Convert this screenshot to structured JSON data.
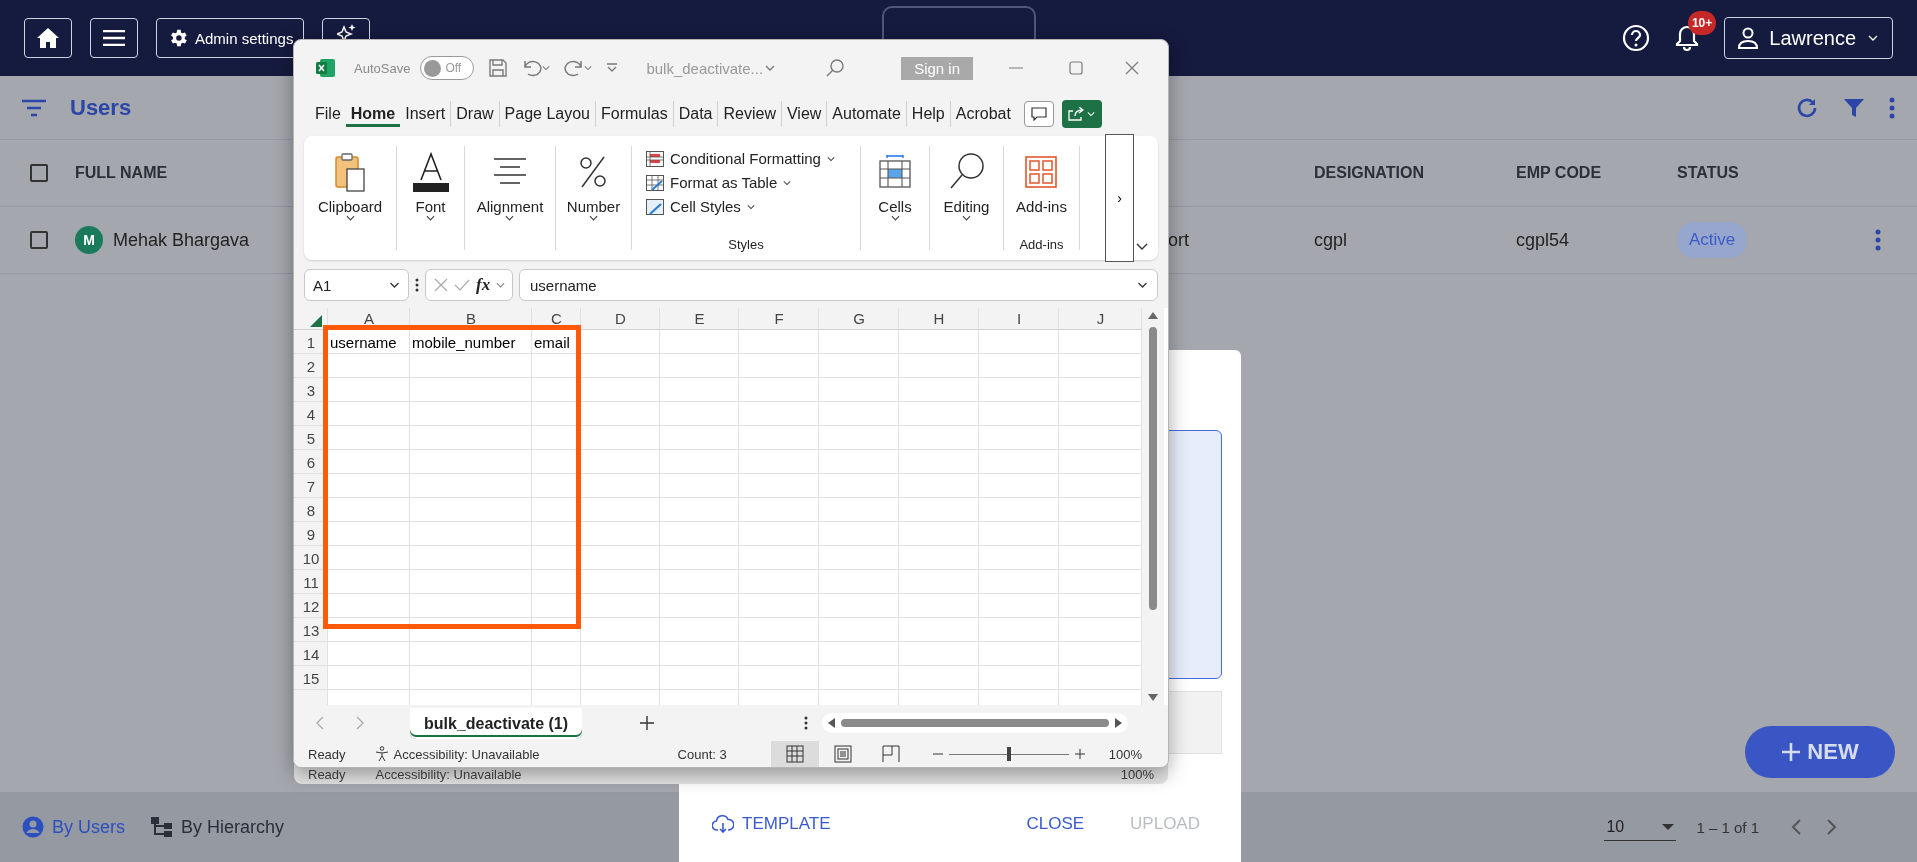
{
  "navbar": {
    "admin_button": "Admin settings",
    "notification_badge": "10+",
    "user_button": "Lawrence"
  },
  "users_header": {
    "title": "Users"
  },
  "table": {
    "header_checked": false,
    "columns": [
      "FULL NAME",
      "DESIGNATION",
      "EMP CODE",
      "STATUS"
    ],
    "rows": [
      {
        "checked": false,
        "avatar": "M",
        "full_name": "Mehak Bhargava",
        "column_3": "ort",
        "designation": "cgpl",
        "emp_code": "cgpl54",
        "status": "Active"
      }
    ]
  },
  "fab": {
    "label": "NEW"
  },
  "footer": {
    "views": [
      {
        "label": "By Users",
        "selected": true
      },
      {
        "label": "By Hierarchy",
        "selected": false
      }
    ],
    "page_size": "10",
    "range": "1 – 1 of 1"
  },
  "dialog": {
    "buttons": [
      {
        "label": "TEMPLATE",
        "disabled": false
      },
      {
        "label": "CLOSE",
        "disabled": false
      },
      {
        "label": "UPLOAD",
        "disabled": true
      }
    ]
  },
  "ghost_status_bar": {
    "ready": "Ready",
    "accessibility": "Accessibility: Unavailable",
    "zoom": "100%"
  },
  "excel": {
    "autosave_label": "AutoSave",
    "autosave": {
      "on": false,
      "label": "Off"
    },
    "file_name": "bulk_deactivate...",
    "sign_in": "Sign in",
    "menu_tabs": [
      {
        "label": "File",
        "selected": false
      },
      {
        "label": "Home",
        "selected": true
      },
      {
        "label": "Insert",
        "selected": false
      },
      {
        "label": "Draw",
        "selected": false
      },
      {
        "label": "Page Layou",
        "selected": false
      },
      {
        "label": "Formulas",
        "selected": false
      },
      {
        "label": "Data",
        "selected": false
      },
      {
        "label": "Review",
        "selected": false
      },
      {
        "label": "View",
        "selected": false
      },
      {
        "label": "Automate",
        "selected": false
      },
      {
        "label": "Help",
        "selected": false
      },
      {
        "label": "Acrobat",
        "selected": false
      }
    ],
    "ribbon": [
      {
        "kind": "big",
        "label": "Clipboard"
      },
      {
        "kind": "big",
        "label": "Font"
      },
      {
        "kind": "big",
        "label": "Alignment"
      },
      {
        "kind": "big",
        "label": "Number"
      },
      {
        "kind": "list",
        "items": [
          "Conditional Formatting",
          "Format as Table",
          "Cell Styles"
        ],
        "group_label": "Styles"
      },
      {
        "kind": "big",
        "label": "Cells"
      },
      {
        "kind": "big",
        "label": "Editing"
      },
      {
        "kind": "addin",
        "label": "Add-ins",
        "group_label": "Add-ins"
      }
    ],
    "ribbon_overflow": "›",
    "name_box": "A1",
    "fx": "fx",
    "formula": "username",
    "columns": [
      "A",
      "B",
      "C",
      "D",
      "E",
      "F",
      "G",
      "H",
      "I",
      "J"
    ],
    "rows": [
      "1",
      "2",
      "3",
      "4",
      "5",
      "6",
      "7",
      "8",
      "9",
      "10",
      "11",
      "12",
      "13",
      "14",
      "15"
    ],
    "cells": [
      [
        "username",
        "mobile_number",
        "email"
      ]
    ],
    "sheet_tab": {
      "label": "bulk_deactivate (1)",
      "selected": true
    },
    "status": {
      "ready": "Ready",
      "accessibility": "Accessibility: Unavailable",
      "count": "Count: 3",
      "view_buttons": [
        {
          "selected": true
        },
        {
          "selected": false
        },
        {
          "selected": false
        }
      ],
      "zoom_slider": {
        "level": 0.5
      },
      "zoom": "100%"
    }
  }
}
